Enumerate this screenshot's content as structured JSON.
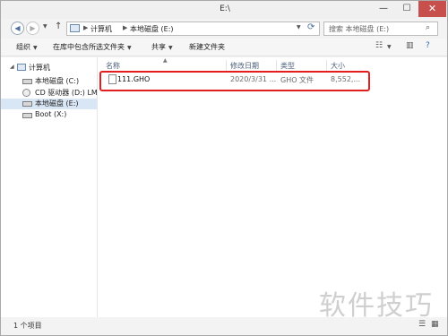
{
  "window": {
    "title": "E:\\"
  },
  "controls": {
    "minimize": "—",
    "maximize": "☐",
    "close": "✕"
  },
  "address": {
    "crumbs": [
      "计算机",
      "本地磁盘 (E:)"
    ]
  },
  "search": {
    "placeholder": "搜索 本地磁盘 (E:)"
  },
  "toolbar": {
    "organize": "组织",
    "include_in_library": "在库中包含所选文件夹",
    "share": "共享",
    "new_folder": "新建文件夹"
  },
  "nav": {
    "items": [
      {
        "label": "计算机"
      },
      {
        "label": "本地磁盘 (C:)"
      },
      {
        "label": "CD 驱动器 (D:) LM"
      },
      {
        "label": "本地磁盘 (E:)"
      },
      {
        "label": "Boot (X:)"
      }
    ]
  },
  "columns": {
    "name": "名称",
    "modified": "修改日期",
    "type": "类型",
    "size": "大小"
  },
  "files": [
    {
      "name": "111.GHO",
      "modified": "2020/3/31 ...",
      "type": "GHO 文件",
      "size": "8,552,..."
    }
  ],
  "status": {
    "count": "1 个项目"
  },
  "watermark": "软件技巧"
}
